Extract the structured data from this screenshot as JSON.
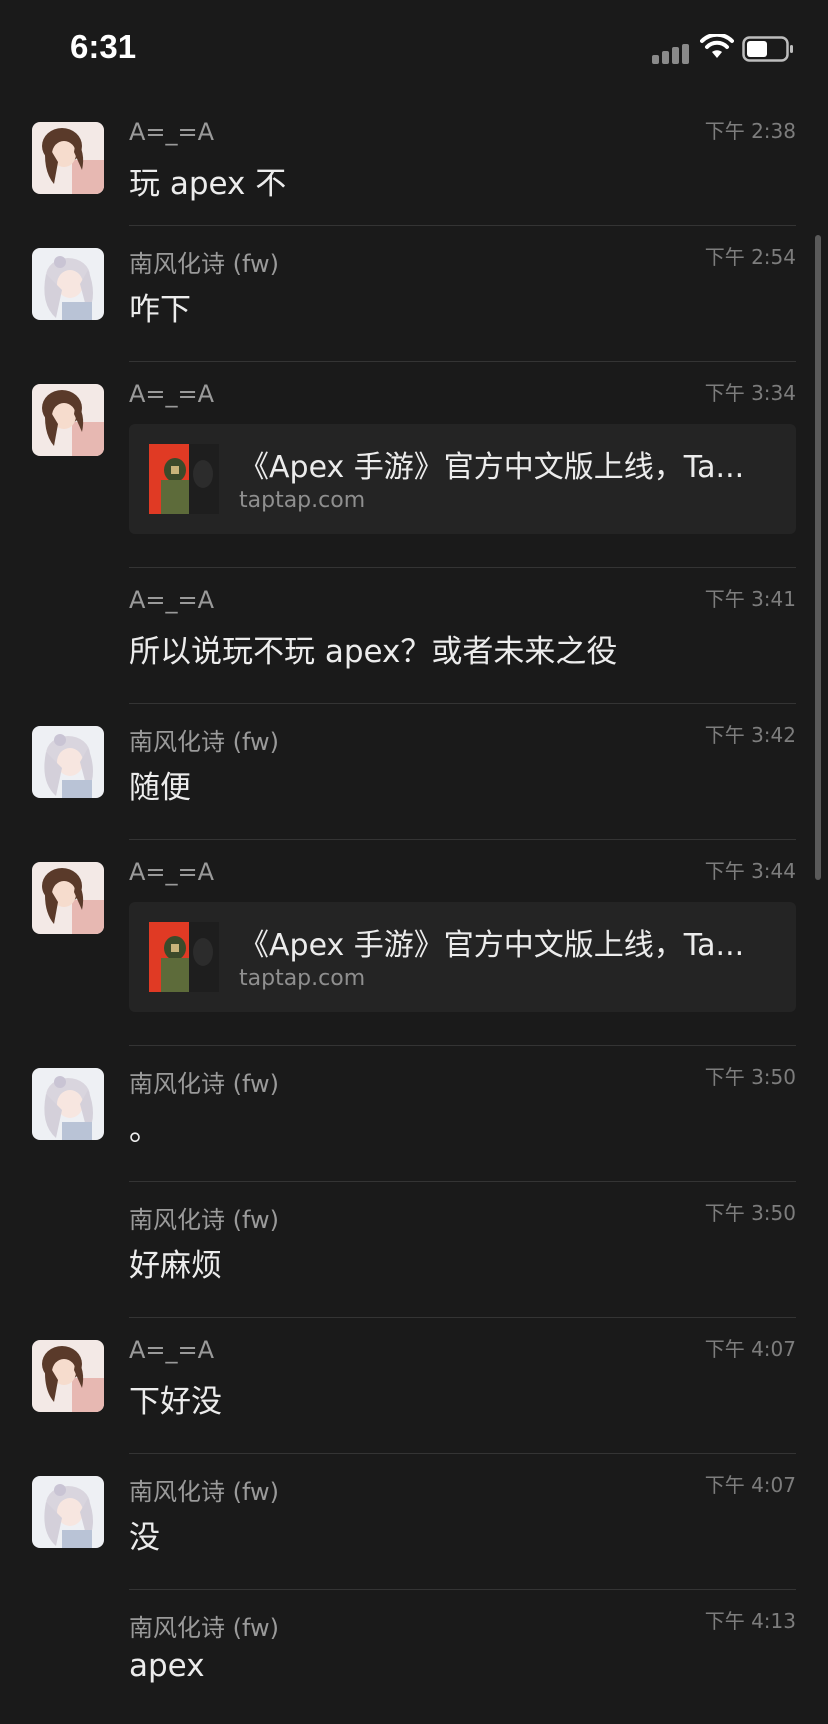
{
  "status_bar": {
    "time": "6:31"
  },
  "messages": [
    {
      "sender": "A=_=A",
      "time": "下午 2:38",
      "text": "玩 apex 不",
      "avatar": "avatar-a"
    },
    {
      "sender": "南风化诗 (fw)",
      "time": "下午 2:54",
      "text": "咋下",
      "avatar": "avatar-nf"
    },
    {
      "sender": "A=_=A",
      "time": "下午 3:34",
      "avatar": "avatar-a",
      "link": {
        "title": "《Apex 手游》官方中文版上线，Ta...",
        "domain": "taptap.com"
      }
    },
    {
      "sender": "A=_=A",
      "time": "下午 3:41",
      "text": "所以说玩不玩 apex？或者未来之役"
    },
    {
      "sender": "南风化诗 (fw)",
      "time": "下午 3:42",
      "text": "随便",
      "avatar": "avatar-nf"
    },
    {
      "sender": "A=_=A",
      "time": "下午 3:44",
      "avatar": "avatar-a",
      "link": {
        "title": "《Apex 手游》官方中文版上线，Ta...",
        "domain": "taptap.com"
      }
    },
    {
      "sender": "南风化诗 (fw)",
      "time": "下午 3:50",
      "text": "。",
      "avatar": "avatar-nf"
    },
    {
      "sender": "南风化诗 (fw)",
      "time": "下午 3:50",
      "text": "好麻烦"
    },
    {
      "sender": "A=_=A",
      "time": "下午 4:07",
      "text": "下好没",
      "avatar": "avatar-a"
    },
    {
      "sender": "南风化诗 (fw)",
      "time": "下午 4:07",
      "text": "没",
      "avatar": "avatar-nf"
    },
    {
      "sender": "南风化诗 (fw)",
      "time": "下午 4:13",
      "text": "apex"
    }
  ]
}
